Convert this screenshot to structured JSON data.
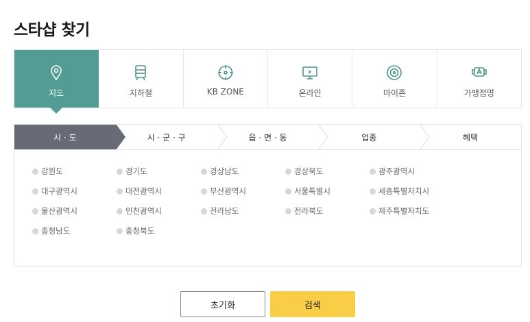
{
  "title": "스타샵 찾기",
  "categories": [
    {
      "label": "지도",
      "icon": "map-pin-icon"
    },
    {
      "label": "지하철",
      "icon": "subway-icon"
    },
    {
      "label": "KB ZONE",
      "icon": "crosshair-icon"
    },
    {
      "label": "온라인",
      "icon": "monitor-icon"
    },
    {
      "label": "마이존",
      "icon": "target-circle-icon"
    },
    {
      "label": "가맹점명",
      "icon": "search-store-icon"
    }
  ],
  "steps": [
    {
      "label": "시 · 도"
    },
    {
      "label": "시 · 군 · 구"
    },
    {
      "label": "읍 · 면 · 동"
    },
    {
      "label": "업종"
    },
    {
      "label": "혜택"
    }
  ],
  "regions": [
    "강원도",
    "경기도",
    "경상남도",
    "경상북도",
    "광주광역시",
    "대구광역시",
    "대전광역시",
    "부산광역시",
    "서울특별시",
    "세종특별자치시",
    "울산광역시",
    "인천광역시",
    "전라남도",
    "전라북도",
    "제주특별자치도",
    "충청남도",
    "충청북도"
  ],
  "buttons": {
    "reset": "초기화",
    "search": "검색"
  },
  "colors": {
    "accent": "#519c94",
    "step_active": "#676b75",
    "search_button": "#f9cd45"
  }
}
